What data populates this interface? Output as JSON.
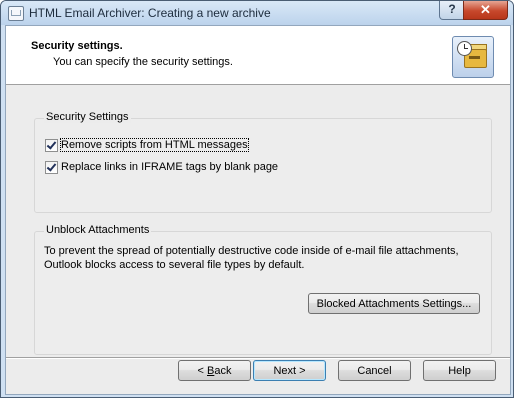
{
  "window": {
    "title": "HTML Email Archiver: Creating a new archive",
    "controls": {
      "help": "?",
      "close": "✕"
    }
  },
  "header": {
    "title": "Security settings.",
    "subtitle": "You can specify the security settings.",
    "icon": "archive-clock-icon"
  },
  "security_group": {
    "title": "Security Settings",
    "options": [
      {
        "label": "Remove scripts from HTML messages",
        "checked": true,
        "focused": true
      },
      {
        "label": "Replace links in IFRAME tags by blank page",
        "checked": true,
        "focused": false
      }
    ]
  },
  "unblock_group": {
    "title": "Unblock Attachments",
    "description_line1": "To prevent the spread of potentially destructive code inside of e-mail file attachments,",
    "description_line2": "Outlook blocks access to several file types by default.",
    "settings_button": "Blocked Attachments Settings..."
  },
  "buttons": {
    "back_mnemonic": "B",
    "back_prefix": "< ",
    "back_rest": "ack",
    "next": "Next >",
    "cancel": "Cancel",
    "help": "Help"
  },
  "colors": {
    "title_bar": "#cfe0f2",
    "close_button": "#c7482c",
    "dialog_background": "#ececec",
    "default_button_border": "#3c7fb1"
  }
}
